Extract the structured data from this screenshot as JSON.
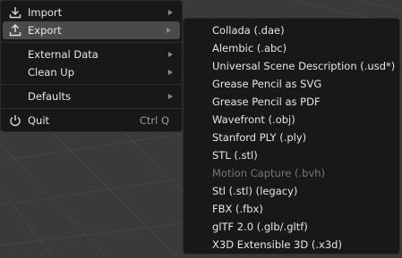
{
  "file_menu": {
    "import_label": "Import",
    "export_label": "Export",
    "external_data_label": "External Data",
    "clean_up_label": "Clean Up",
    "defaults_label": "Defaults",
    "quit_label": "Quit",
    "quit_shortcut": "Ctrl Q"
  },
  "export_submenu": {
    "items": [
      {
        "label": "Collada (.dae)"
      },
      {
        "label": "Alembic (.abc)"
      },
      {
        "label": "Universal Scene Description (.usd*)"
      },
      {
        "label": "Grease Pencil as SVG"
      },
      {
        "label": "Grease Pencil as PDF"
      },
      {
        "label": "Wavefront (.obj)"
      },
      {
        "label": "Stanford PLY (.ply)"
      },
      {
        "label": "STL (.stl)"
      },
      {
        "label": "Motion Capture (.bvh)"
      },
      {
        "label": "Stl (.stl) (legacy)"
      },
      {
        "label": "FBX (.fbx)"
      },
      {
        "label": "glTF 2.0 (.glb/.gltf)"
      },
      {
        "label": "X3D Extensible 3D (.x3d)"
      }
    ]
  },
  "colors": {
    "menu_bg": "#181818",
    "highlight": "#4a4a4a",
    "text": "#e6e6e6",
    "disabled_text": "#777777"
  }
}
